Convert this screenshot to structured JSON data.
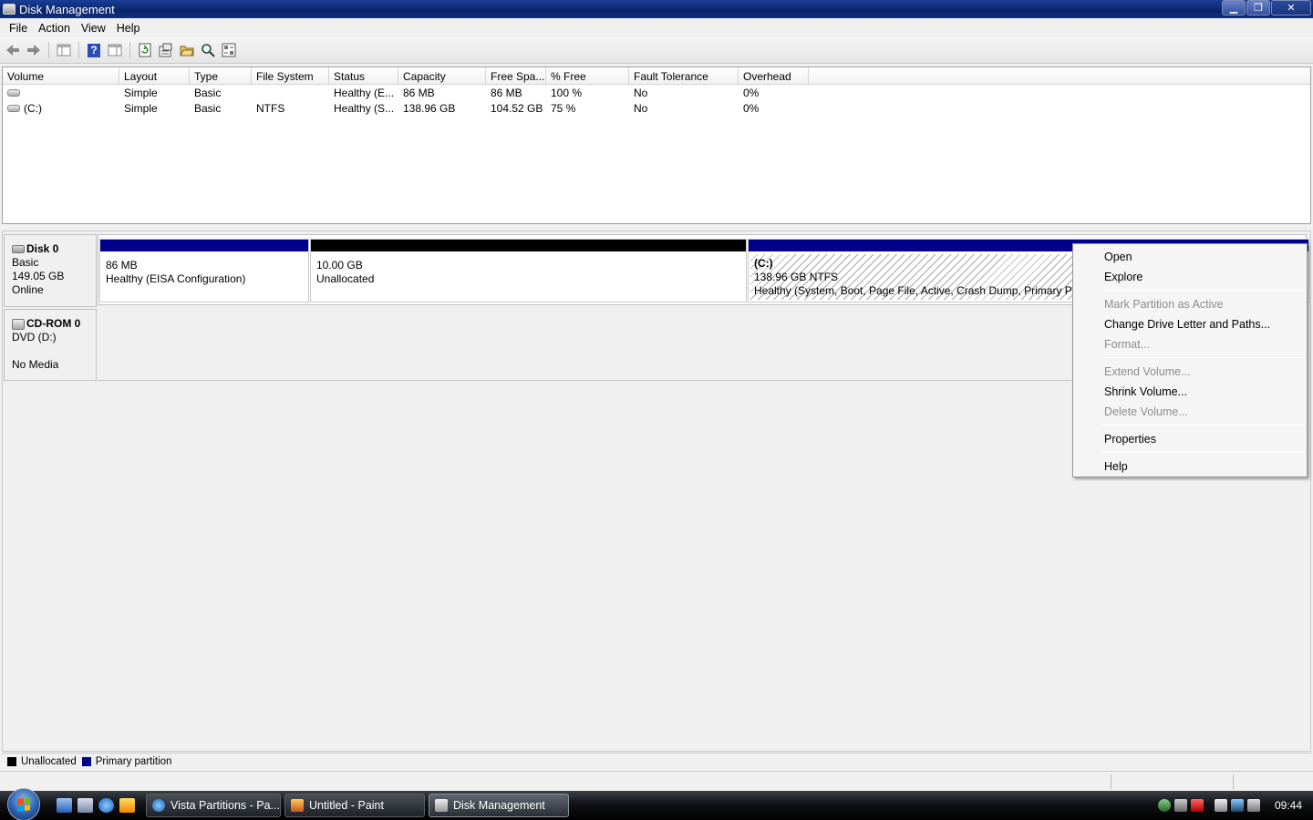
{
  "window": {
    "title": "Disk Management"
  },
  "window_buttons": {
    "minimize": "▁",
    "restore": "❐",
    "close": "✕"
  },
  "menu": [
    "File",
    "Action",
    "View",
    "Help"
  ],
  "toolbar": {
    "icons": [
      "back-icon",
      "forward-icon",
      "console-tree-icon",
      "help-icon",
      "show-hide-icon",
      "refresh-icon",
      "properties-icon",
      "open-icon",
      "explore-icon",
      "settings-icon"
    ],
    "help_glyph": "?"
  },
  "volume_list": {
    "columns": [
      "Volume",
      "Layout",
      "Type",
      "File System",
      "Status",
      "Capacity",
      "Free Spa...",
      "% Free",
      "Fault Tolerance",
      "Overhead"
    ],
    "rows": [
      [
        "",
        "Simple",
        "Basic",
        "",
        "Healthy (E...",
        "86 MB",
        "86 MB",
        "100 %",
        "No",
        "0%"
      ],
      [
        "(C:)",
        "Simple",
        "Basic",
        "NTFS",
        "Healthy (S...",
        "138.96 GB",
        "104.52 GB",
        "75 %",
        "No",
        "0%"
      ]
    ]
  },
  "disks": {
    "disk0": {
      "name": "Disk 0",
      "type": "Basic",
      "size": "149.05 GB",
      "state": "Online",
      "partitions": [
        {
          "size": "86 MB",
          "status": "Healthy (EISA Configuration)"
        },
        {
          "size": "10.00 GB",
          "status": "Unallocated"
        },
        {
          "label": "(C:)",
          "size": "138.96 GB NTFS",
          "status": "Healthy (System, Boot, Page File, Active, Crash Dump, Primary Part"
        }
      ]
    },
    "cdrom0": {
      "name": "CD-ROM 0",
      "type": "DVD (D:)",
      "state": "No Media"
    }
  },
  "legend": {
    "unallocated": "Unallocated",
    "primary": "Primary partition",
    "colors": {
      "unallocated": "#000000",
      "primary": "#00008b"
    }
  },
  "context_menu": {
    "open": "Open",
    "explore": "Explore",
    "mark_active": "Mark Partition as Active",
    "change_letter": "Change Drive Letter and Paths...",
    "format": "Format...",
    "extend": "Extend Volume...",
    "shrink": "Shrink Volume...",
    "delete": "Delete Volume...",
    "properties": "Properties",
    "help": "Help"
  },
  "taskbar": {
    "tasks": [
      "Vista Partitions - Pa...",
      "Untitled - Paint",
      "Disk Management"
    ],
    "clock": "09:44"
  }
}
